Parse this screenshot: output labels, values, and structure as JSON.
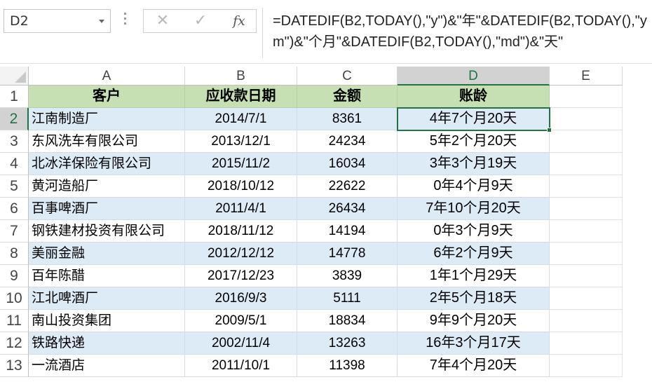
{
  "formula_bar": {
    "name_box": "D2",
    "cancel_icon": "✕",
    "enter_icon": "✓",
    "fx_label": "fx",
    "formula": "=DATEDIF(B2,TODAY(),\"y\")&\"年\"&DATEDIF(B2,TODAY(),\"ym\")&\"个月\"&DATEDIF(B2,TODAY(),\"md\")&\"天\""
  },
  "columns": [
    "A",
    "B",
    "C",
    "D",
    "E"
  ],
  "selected_cell": "D2",
  "header": {
    "customer": "客户",
    "due_date": "应收款日期",
    "amount": "金额",
    "age": "账龄"
  },
  "rows": [
    {
      "num": "1"
    },
    {
      "num": "2",
      "customer": "江南制造厂",
      "due_date": "2014/7/1",
      "amount": "8361",
      "age": "4年7个月20天"
    },
    {
      "num": "3",
      "customer": "东风洗车有限公司",
      "due_date": "2013/12/1",
      "amount": "24234",
      "age": "5年2个月20天"
    },
    {
      "num": "4",
      "customer": "北冰洋保险有限公司",
      "due_date": "2015/11/2",
      "amount": "16034",
      "age": "3年3个月19天"
    },
    {
      "num": "5",
      "customer": "黄河造船厂",
      "due_date": "2018/10/12",
      "amount": "22622",
      "age": "0年4个月9天"
    },
    {
      "num": "6",
      "customer": "百事啤酒厂",
      "due_date": "2011/4/1",
      "amount": "26434",
      "age": "7年10个月20天"
    },
    {
      "num": "7",
      "customer": "钢铁建材投资有限公司",
      "due_date": "2018/11/12",
      "amount": "14194",
      "age": "0年3个月9天"
    },
    {
      "num": "8",
      "customer": "美丽金融",
      "due_date": "2012/12/12",
      "amount": "14778",
      "age": "6年2个月9天"
    },
    {
      "num": "9",
      "customer": "百年陈醋",
      "due_date": "2017/12/23",
      "amount": "3839",
      "age": "1年1个月29天"
    },
    {
      "num": "10",
      "customer": "江北啤酒厂",
      "due_date": "2016/9/3",
      "amount": "5111",
      "age": "2年5个月18天"
    },
    {
      "num": "11",
      "customer": "南山投资集团",
      "due_date": "2009/5/1",
      "amount": "18834",
      "age": "9年9个月20天"
    },
    {
      "num": "12",
      "customer": "铁路快递",
      "due_date": "2002/11/4",
      "amount": "13263",
      "age": "16年3个月17天"
    },
    {
      "num": "13",
      "customer": "一流酒店",
      "due_date": "2011/10/1",
      "amount": "11398",
      "age": "7年4个月20天"
    }
  ]
}
